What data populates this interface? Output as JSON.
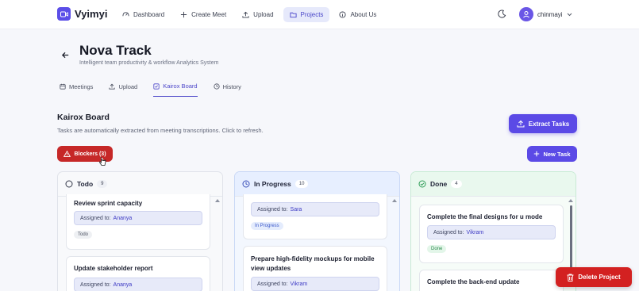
{
  "app": {
    "name": "Vyimyi"
  },
  "nav": {
    "items": [
      {
        "label": "Dashboard",
        "icon": "dashboard-icon"
      },
      {
        "label": "Create Meet",
        "icon": "plus-icon"
      },
      {
        "label": "Upload",
        "icon": "upload-icon"
      },
      {
        "label": "Projects",
        "icon": "folder-icon",
        "active": true
      },
      {
        "label": "About Us",
        "icon": "info-icon"
      }
    ]
  },
  "user": {
    "name": "chinmayi"
  },
  "project": {
    "title": "Nova Track",
    "subtitle": "Intelligent team productivity & workflow Analytics System"
  },
  "tabs": [
    {
      "label": "Meetings"
    },
    {
      "label": "Upload"
    },
    {
      "label": "Kairox Board",
      "active": true
    },
    {
      "label": "History"
    }
  ],
  "board": {
    "title": "Kairox Board",
    "description": "Tasks are automatically extracted from meeting transcriptions. Click to refresh.",
    "extract_label": "Extract Tasks",
    "new_task_label": "New Task",
    "blockers_label": "Blockers (3)"
  },
  "columns": {
    "todo": {
      "label": "Todo",
      "count": "9",
      "cards": [
        {
          "title": "Review sprint capacity",
          "assigned_prefix": "Assigned to:",
          "assignee": "Ananya",
          "tag": "Todo"
        },
        {
          "title": "Update stakeholder report",
          "assigned_prefix": "Assigned to:",
          "assignee": "Ananya"
        }
      ]
    },
    "progress": {
      "label": "In Progress",
      "count": "10",
      "cards": [
        {
          "assigned_prefix": "Assigned to:",
          "assignee": "Sara",
          "tag": "In Progress"
        },
        {
          "title_line1": "Prepare high-fidelity mockups for mobile",
          "title_line2": "view updates",
          "assigned_prefix": "Assigned to:",
          "assignee": "Vikram"
        }
      ]
    },
    "done": {
      "label": "Done",
      "count": "4",
      "cards": [
        {
          "title": "Complete the final designs for u mode",
          "assigned_prefix": "Assigned to:",
          "assignee": "Vikram",
          "tag": "Done"
        },
        {
          "title": "Complete the back-end update"
        }
      ]
    }
  },
  "delete_label": "Delete Project",
  "colors": {
    "accent": "#5b4ae6",
    "danger": "#c62828",
    "progress_tint": "#e7efff",
    "done_tint": "#e9f8ee"
  }
}
